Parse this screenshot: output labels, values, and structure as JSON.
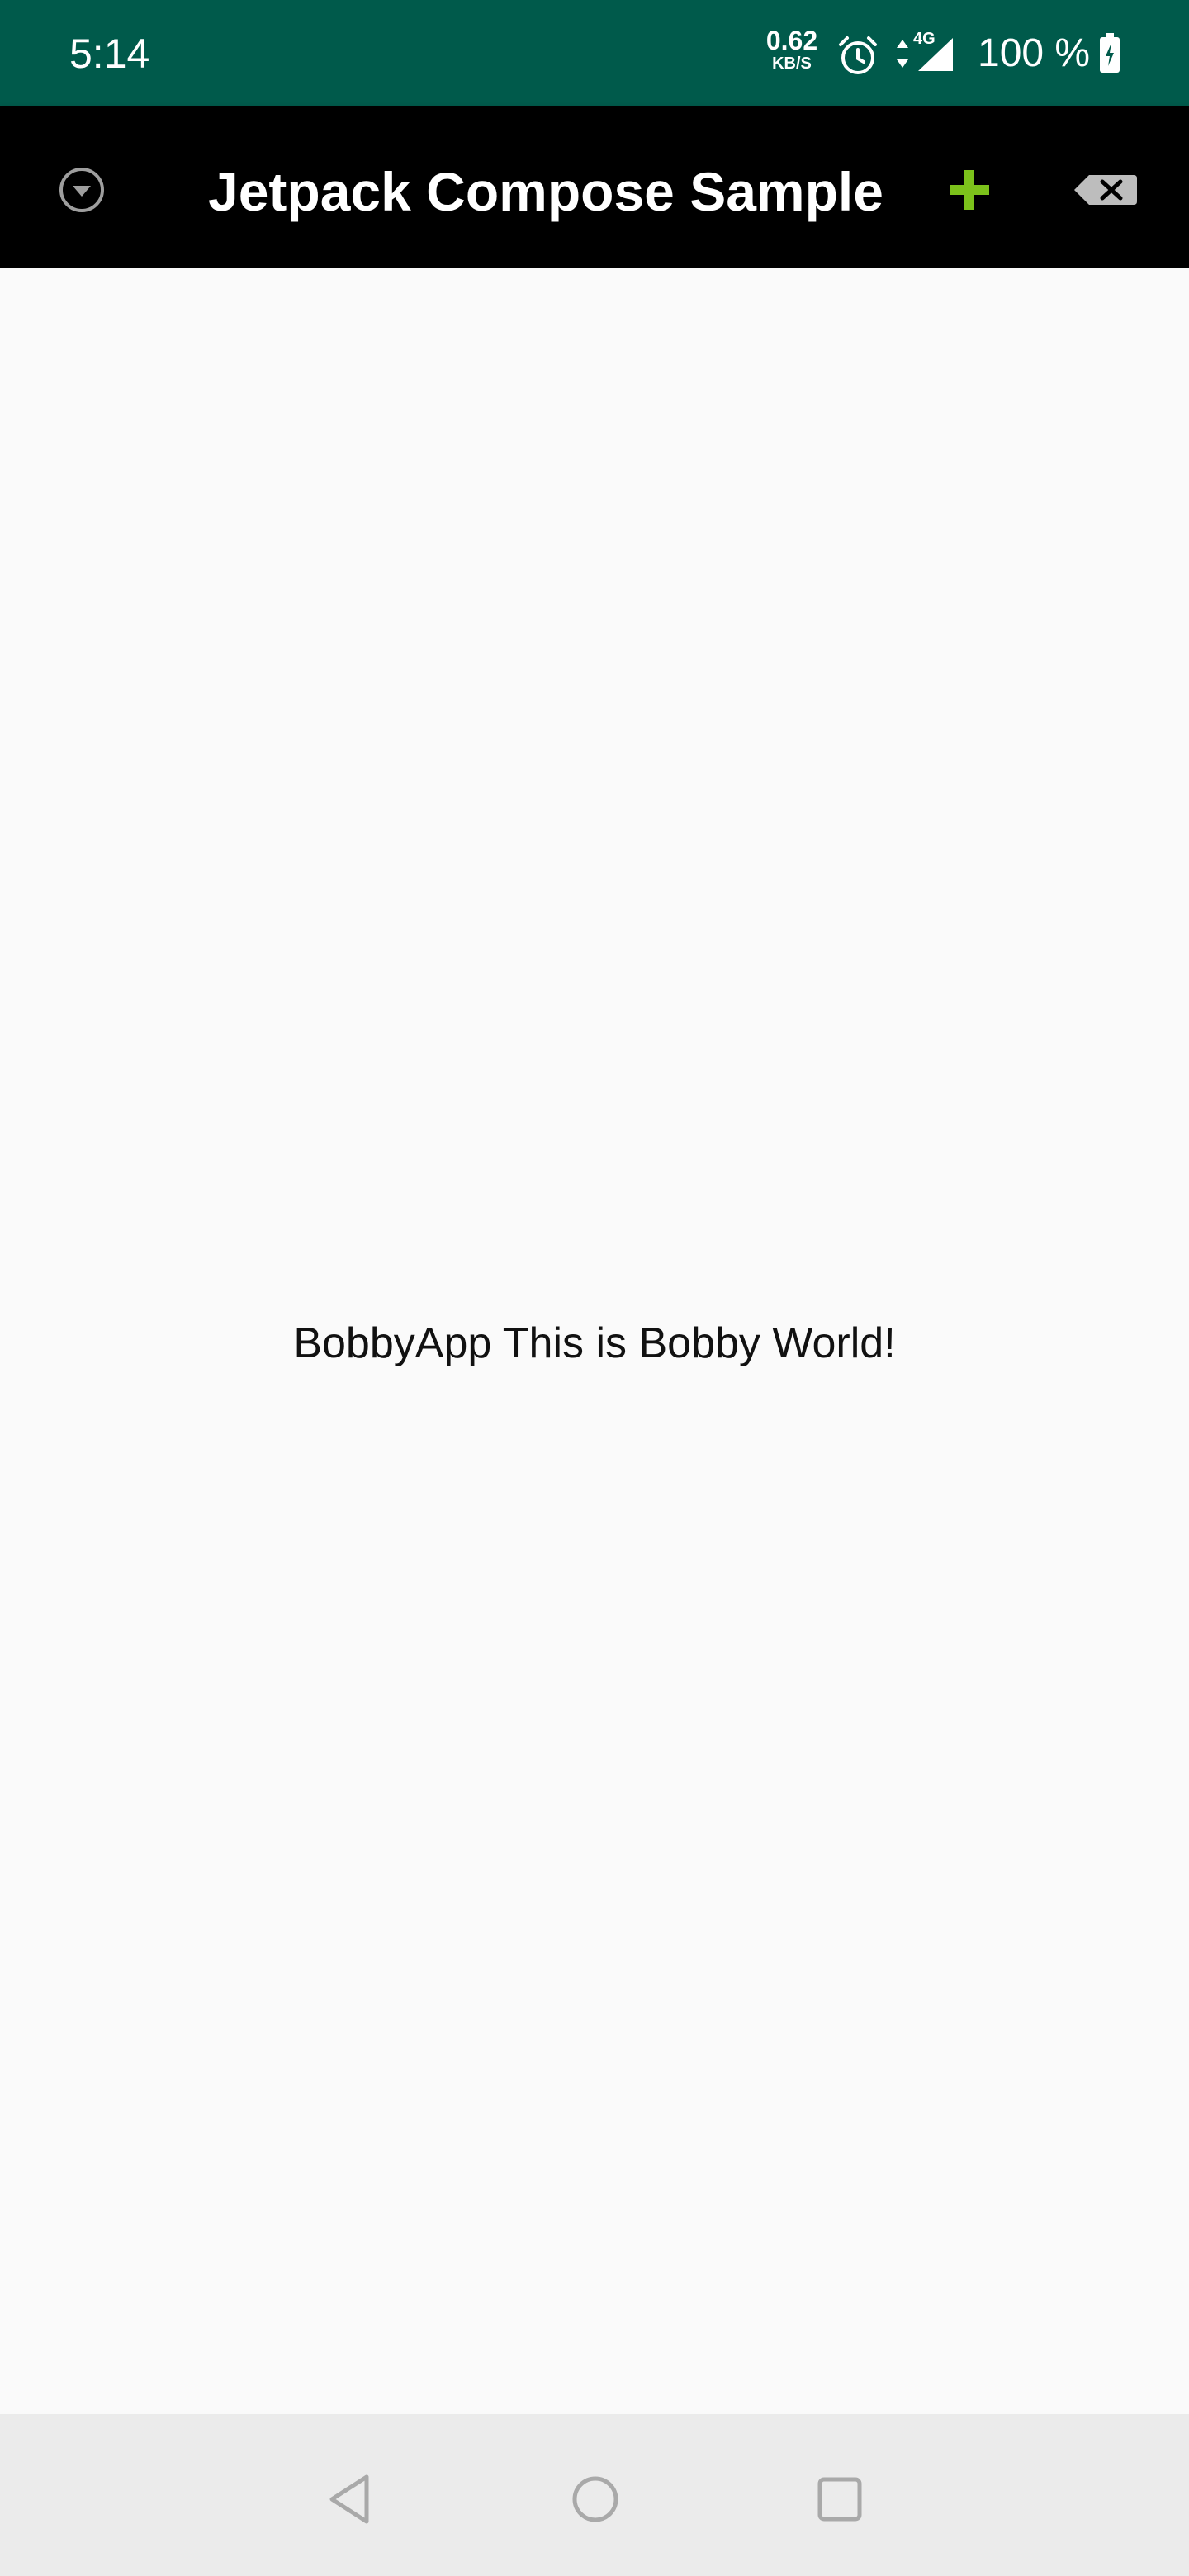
{
  "status_bar": {
    "time": "5:14",
    "net_speed_value": "0.62",
    "net_speed_unit": "KB/S",
    "network_type": "4G",
    "battery": "100 %",
    "background_color": "#005a4b"
  },
  "app_bar": {
    "title": "Jetpack Compose Sample",
    "menu_icon": "dropdown-circle-icon",
    "add_icon": "plus-icon",
    "clear_icon": "backspace-icon",
    "add_color": "#7cc21b",
    "background_color": "#000000"
  },
  "content": {
    "greeting": "BobbyApp This is Bobby World!"
  },
  "nav_bar": {
    "back_icon": "triangle-back-icon",
    "home_icon": "circle-home-icon",
    "recents_icon": "square-recents-icon"
  }
}
